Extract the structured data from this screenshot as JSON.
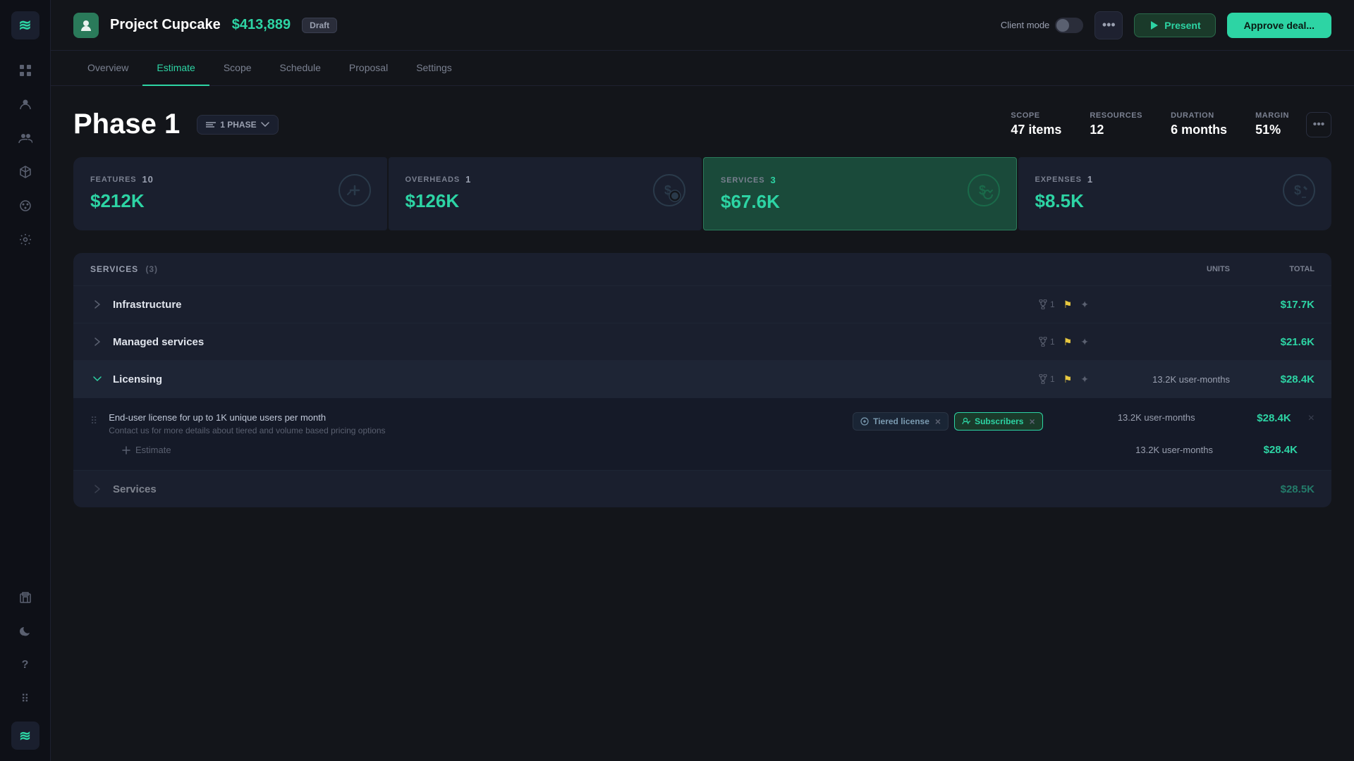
{
  "app": {
    "logo_symbol": "≋"
  },
  "header": {
    "project_icon": "👤",
    "project_name": "Project Cupcake",
    "project_amount": "$413,889",
    "draft_label": "Draft",
    "client_mode_label": "Client mode",
    "more_icon": "•••",
    "present_label": "Present",
    "approve_label": "Approve deal..."
  },
  "nav": {
    "tabs": [
      {
        "id": "overview",
        "label": "Overview"
      },
      {
        "id": "estimate",
        "label": "Estimate",
        "active": true
      },
      {
        "id": "scope",
        "label": "Scope"
      },
      {
        "id": "schedule",
        "label": "Schedule"
      },
      {
        "id": "proposal",
        "label": "Proposal"
      },
      {
        "id": "settings",
        "label": "Settings"
      }
    ]
  },
  "sidebar": {
    "icons": [
      {
        "id": "waves",
        "symbol": "≋"
      },
      {
        "id": "grid",
        "symbol": "⊞"
      },
      {
        "id": "person",
        "symbol": "👤"
      },
      {
        "id": "group",
        "symbol": "👥"
      },
      {
        "id": "box",
        "symbol": "⬡"
      },
      {
        "id": "palette",
        "symbol": "🎨"
      },
      {
        "id": "gear",
        "symbol": "⚙"
      }
    ],
    "bottom_icons": [
      {
        "id": "building",
        "symbol": "🏢"
      },
      {
        "id": "moon",
        "symbol": "◑"
      },
      {
        "id": "question",
        "symbol": "?"
      },
      {
        "id": "dots",
        "symbol": "⠿"
      },
      {
        "id": "logo2",
        "symbol": "≋"
      }
    ]
  },
  "phase": {
    "title": "Phase 1",
    "selector_label": "1 PHASE",
    "stats": {
      "scope_label": "SCOPE",
      "scope_value": "47 items",
      "resources_label": "RESOURCES",
      "resources_value": "12",
      "duration_label": "DURATION",
      "duration_value": "6 months",
      "margin_label": "MARGIN",
      "margin_value": "51%"
    }
  },
  "summary_cards": [
    {
      "id": "features",
      "label": "FEATURES",
      "count": "10",
      "value": "$212K",
      "icon": "🔧",
      "active": false
    },
    {
      "id": "overheads",
      "label": "OVERHEADS",
      "count": "1",
      "value": "$126K",
      "icon": "💰",
      "active": false
    },
    {
      "id": "services",
      "label": "SERVICES",
      "count": "3",
      "value": "$67.6K",
      "icon": "🔄",
      "active": true
    },
    {
      "id": "expenses",
      "label": "EXPENSES",
      "count": "1",
      "value": "$8.5K",
      "icon": "✏️",
      "active": false
    }
  ],
  "services_table": {
    "title": "SERVICES",
    "count": 3,
    "columns": {
      "units": "UNITS",
      "total": "TOTAL"
    },
    "rows": [
      {
        "id": "infrastructure",
        "name": "Infrastructure",
        "version": "1",
        "total": "$17.7K",
        "expanded": false
      },
      {
        "id": "managed-services",
        "name": "Managed services",
        "version": "1",
        "total": "$21.6K",
        "expanded": false
      },
      {
        "id": "licensing",
        "name": "Licensing",
        "version": "1",
        "units": "13.2K user-months",
        "total": "$28.4K",
        "expanded": true,
        "detail": {
          "title": "End-user license for up to 1K unique users per month",
          "subtitle": "Contact us for more details about tiered and volume based pricing options",
          "tags": [
            {
              "id": "tiered-license",
              "label": "Tiered license",
              "type": "tiered"
            },
            {
              "id": "subscribers",
              "label": "Subscribers",
              "type": "subscribers"
            }
          ],
          "units": "13.2K user-months",
          "total": "$28.4K"
        },
        "estimate": {
          "label": "Estimate",
          "units": "13.2K user-months",
          "total": "$28.4K"
        }
      }
    ],
    "partial_row": {
      "name": "Services",
      "total": "$28.5K"
    }
  }
}
